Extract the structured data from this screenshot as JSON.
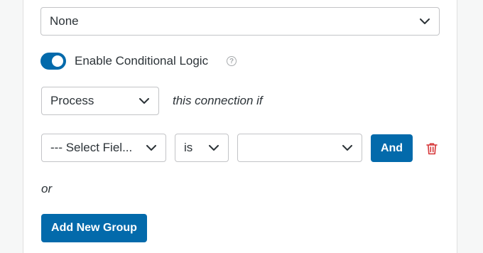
{
  "connection": {
    "select_value": "None"
  },
  "conditional_logic": {
    "toggle_on": true,
    "label": "Enable Conditional Logic",
    "help_symbol": "?"
  },
  "process_row": {
    "action_value": "Process",
    "suffix_text": "this connection if"
  },
  "rule_row": {
    "field_value": "--- Select Fiel...",
    "operator_value": "is",
    "value_value": "",
    "and_label": "And",
    "delete_icon": "trash-icon"
  },
  "or_label": "or",
  "add_group_label": "Add New Group",
  "colors": {
    "accent": "#036aab",
    "delete": "#d63638",
    "border": "#c3c4c7"
  }
}
